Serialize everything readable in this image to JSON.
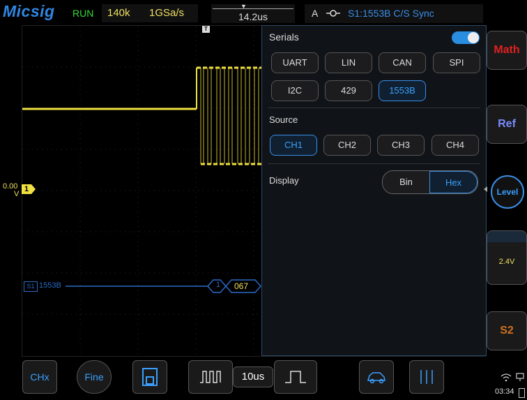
{
  "header": {
    "logo": "Micsig",
    "status": "RUN",
    "memory_depth": "140k",
    "sample_rate": "1GSa/s",
    "trigger_position": "14.2us",
    "trigger_channel": "A",
    "trigger_info": "S1:1553B C/S Sync"
  },
  "waveform": {
    "ch1_offset": "0.00",
    "ch1_offset_unit": "V",
    "ch1_marker": "1",
    "trigger_marker": "T",
    "serial_marker": "S1",
    "serial_label": "1553B",
    "decode_field_1": "1",
    "decode_value": "067"
  },
  "serials_panel": {
    "title": "Serials",
    "enabled": true,
    "protocols": [
      "UART",
      "LIN",
      "CAN",
      "SPI",
      "I2C",
      "429",
      "1553B"
    ],
    "selected_protocol": "1553B",
    "source_label": "Source",
    "sources": [
      "CH1",
      "CH2",
      "CH3",
      "CH4"
    ],
    "selected_source": "CH1",
    "display_label": "Display",
    "display_options": [
      "Bin",
      "Hex"
    ],
    "selected_display": "Hex"
  },
  "right_menu": {
    "math": "Math",
    "ref": "Ref",
    "level": "Level",
    "level_value": "2.4V",
    "s2": "S2"
  },
  "bottom_bar": {
    "chx": "CHx",
    "fine": "Fine",
    "timebase": "10us",
    "clock": "03:34"
  },
  "colors": {
    "accent": "#3aa0ff",
    "ch1": "#f0e040",
    "math": "#e02020",
    "ref": "#7a8cff",
    "s2": "#d07020"
  }
}
